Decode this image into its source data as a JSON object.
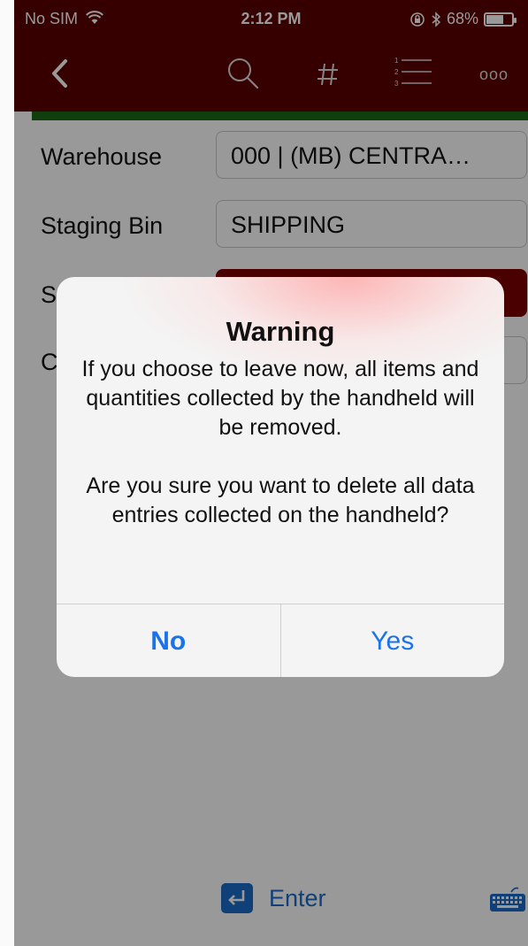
{
  "status_bar": {
    "carrier": "No SIM",
    "time": "2:12 PM",
    "battery_text": "68%",
    "battery_level": 0.68
  },
  "nav": {
    "back_icon": "chevron-left-icon",
    "search_icon": "search-icon",
    "hash_icon": "hash-icon",
    "list_icon": "numbered-list-icon",
    "more_icon": "more-icon",
    "more_label": "ooo"
  },
  "form": {
    "warehouse_label": "Warehouse",
    "warehouse_value": "000 | (MB) CENTRA…",
    "staging_label": "Staging Bin",
    "staging_value": "SHIPPING",
    "row3_label_fragment": "S",
    "row4_label_fragment": "C"
  },
  "bottom": {
    "enter_label": "Enter"
  },
  "dialog": {
    "title": "Warning",
    "message_1": "If you choose to leave now, all items and quantities collected by the handheld will be removed.",
    "message_2": "Are you sure you want to delete all data entries collected on the handheld?",
    "no_label": "No",
    "yes_label": "Yes"
  },
  "colors": {
    "header": "#5c0000",
    "accent_green": "#1c6a16",
    "accent_red_field": "#7d0000",
    "link_blue": "#1a73e8"
  }
}
